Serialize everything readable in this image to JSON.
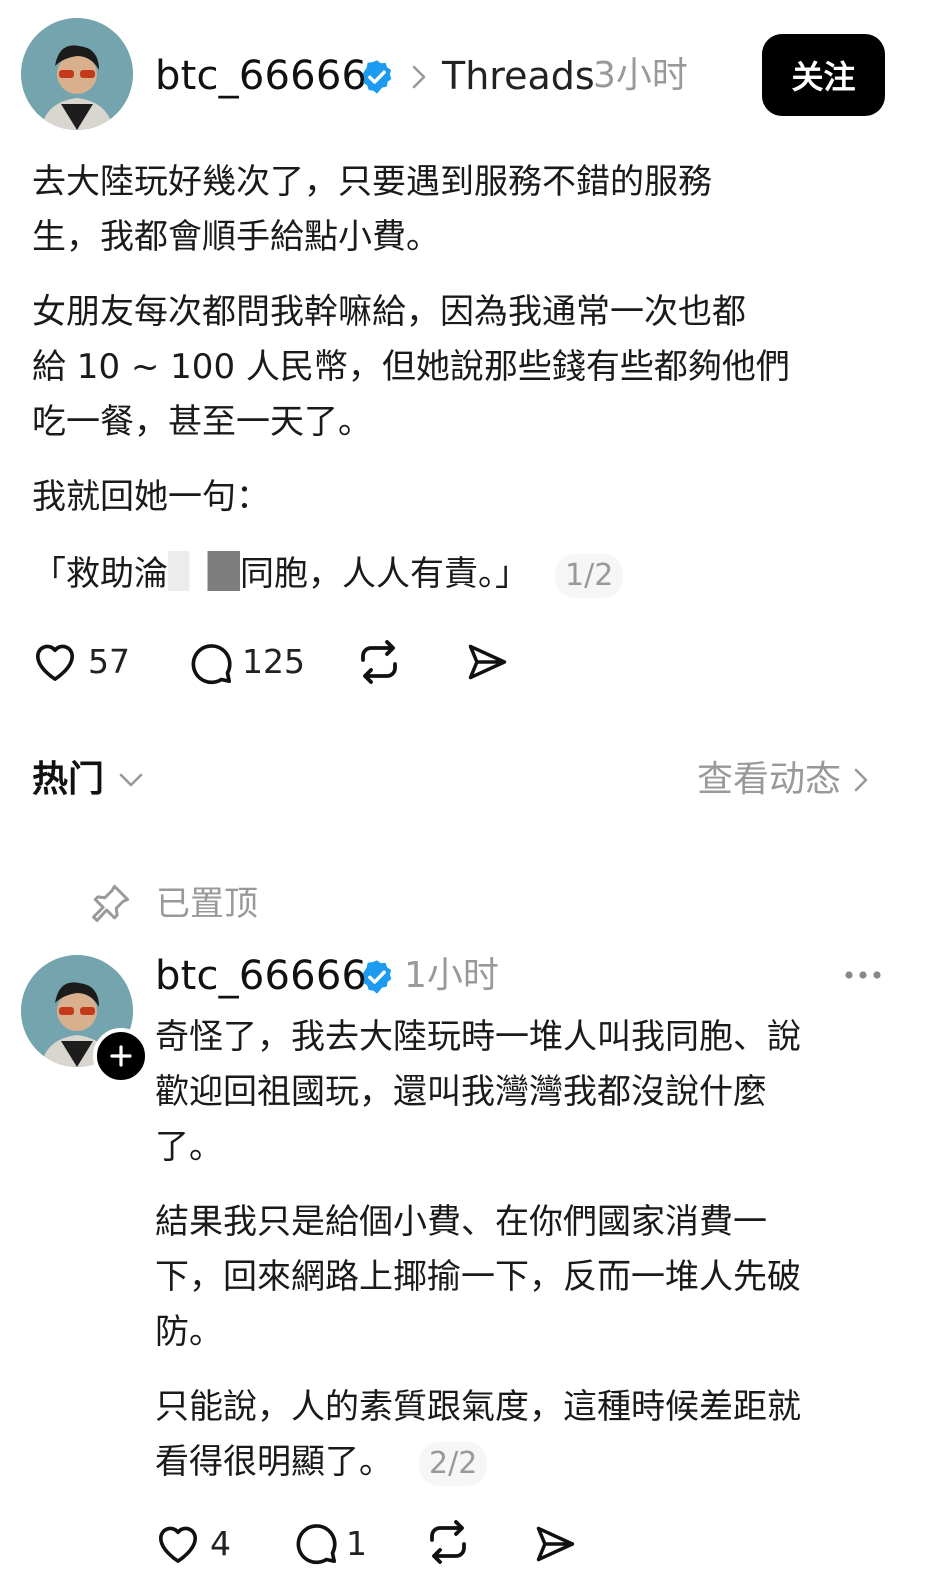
{
  "post": {
    "username": "btc_66666",
    "source": "Threads",
    "time": "3小时",
    "follow_label": "关注",
    "paragraphs": [
      "去大陸玩好幾次了，只要遇到服務不錯的服務\n生，我都會順手給點小費。",
      "女朋友每次都問我幹嘛給，因為我通常一次也都\n給 10 ~ 100 人民幣，但她說那些錢有些都夠他們\n吃一餐，甚至一天了。",
      "我就回她一句："
    ],
    "quote_before": "「救助淪",
    "quote_after": "同胞，人人有責。」",
    "page": "1/2",
    "likes": "57",
    "comments": "125"
  },
  "section": {
    "sort_label": "热门",
    "activity_link": "查看动态"
  },
  "pinned_label": "已置顶",
  "reply": {
    "username": "btc_66666",
    "time": "1小时",
    "paragraphs": [
      "奇怪了，我去大陸玩時一堆人叫我同胞、說\n歡迎回祖國玩，還叫我灣灣我都沒說什麼\n了。",
      "結果我只是給個小費、在你們國家消費一\n下，回來網路上揶揄一下，反而一堆人先破\n防。"
    ],
    "last_paragraph": "只能說，人的素質跟氣度，這種時候差距就\n看得很明顯了。",
    "page": "2/2",
    "likes": "4",
    "comments": "1"
  },
  "colors": {
    "verified": "#1d9bf0",
    "follow_bg": "#000000",
    "muted": "#999999"
  },
  "icons": [
    "verified-badge-icon",
    "chevron-right-icon",
    "heart-icon",
    "comment-icon",
    "repost-icon",
    "share-icon",
    "chevron-down-icon",
    "pin-icon",
    "more-icon",
    "plus-icon"
  ]
}
